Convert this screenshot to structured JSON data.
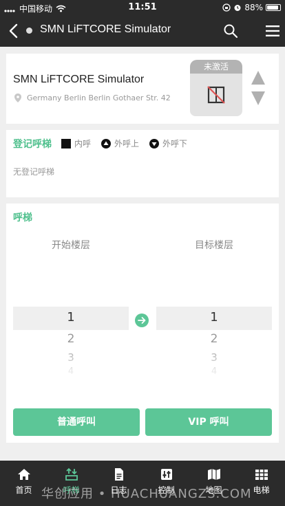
{
  "status_bar": {
    "carrier": "中国移动",
    "time": "11:51",
    "battery": "88%",
    "battery_level": 0.88
  },
  "nav": {
    "title": "SMN LiFTCORE Simulator"
  },
  "device": {
    "name": "SMN LiFTCORE Simulator",
    "address": "Germany Berlin Berlin Gothaer Str. 42",
    "status": "未激活"
  },
  "registered": {
    "title": "登记呼梯",
    "legend_inner": "内呼",
    "legend_up": "外呼上",
    "legend_down": "外呼下",
    "empty": "无登记呼梯"
  },
  "call": {
    "title": "呼梯",
    "start_label": "开始楼层",
    "target_label": "目标楼层",
    "start_floors": [
      "1",
      "2",
      "3",
      "4"
    ],
    "target_floors": [
      "1",
      "2",
      "3",
      "4"
    ],
    "normal_button": "普通呼叫",
    "vip_button": "VIP 呼叫"
  },
  "tabs": [
    {
      "label": "首页",
      "icon": "home-icon"
    },
    {
      "label": "呼梯",
      "icon": "call-icon"
    },
    {
      "label": "日志",
      "icon": "log-icon"
    },
    {
      "label": "控制",
      "icon": "control-icon"
    },
    {
      "label": "地图",
      "icon": "map-icon"
    },
    {
      "label": "电梯",
      "icon": "elevator-icon"
    }
  ],
  "active_tab": 1,
  "watermark": "华创应用 • HUACHUANGZS.COM",
  "colors": {
    "accent": "#5cc697",
    "bar": "#2b2b2b"
  }
}
